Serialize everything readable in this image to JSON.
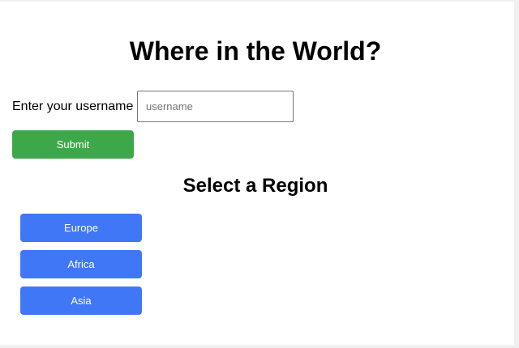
{
  "header": {
    "title": "Where in the World?"
  },
  "login": {
    "label": "Enter your username",
    "input_value": "",
    "input_placeholder": "username",
    "submit_label": "Submit"
  },
  "regions": {
    "title": "Select a Region",
    "items": [
      {
        "label": "Europe"
      },
      {
        "label": "Africa"
      },
      {
        "label": "Asia"
      }
    ]
  },
  "colors": {
    "submit": "#3da84a",
    "region_button": "#4077f6",
    "button_text": "#ffffff"
  }
}
